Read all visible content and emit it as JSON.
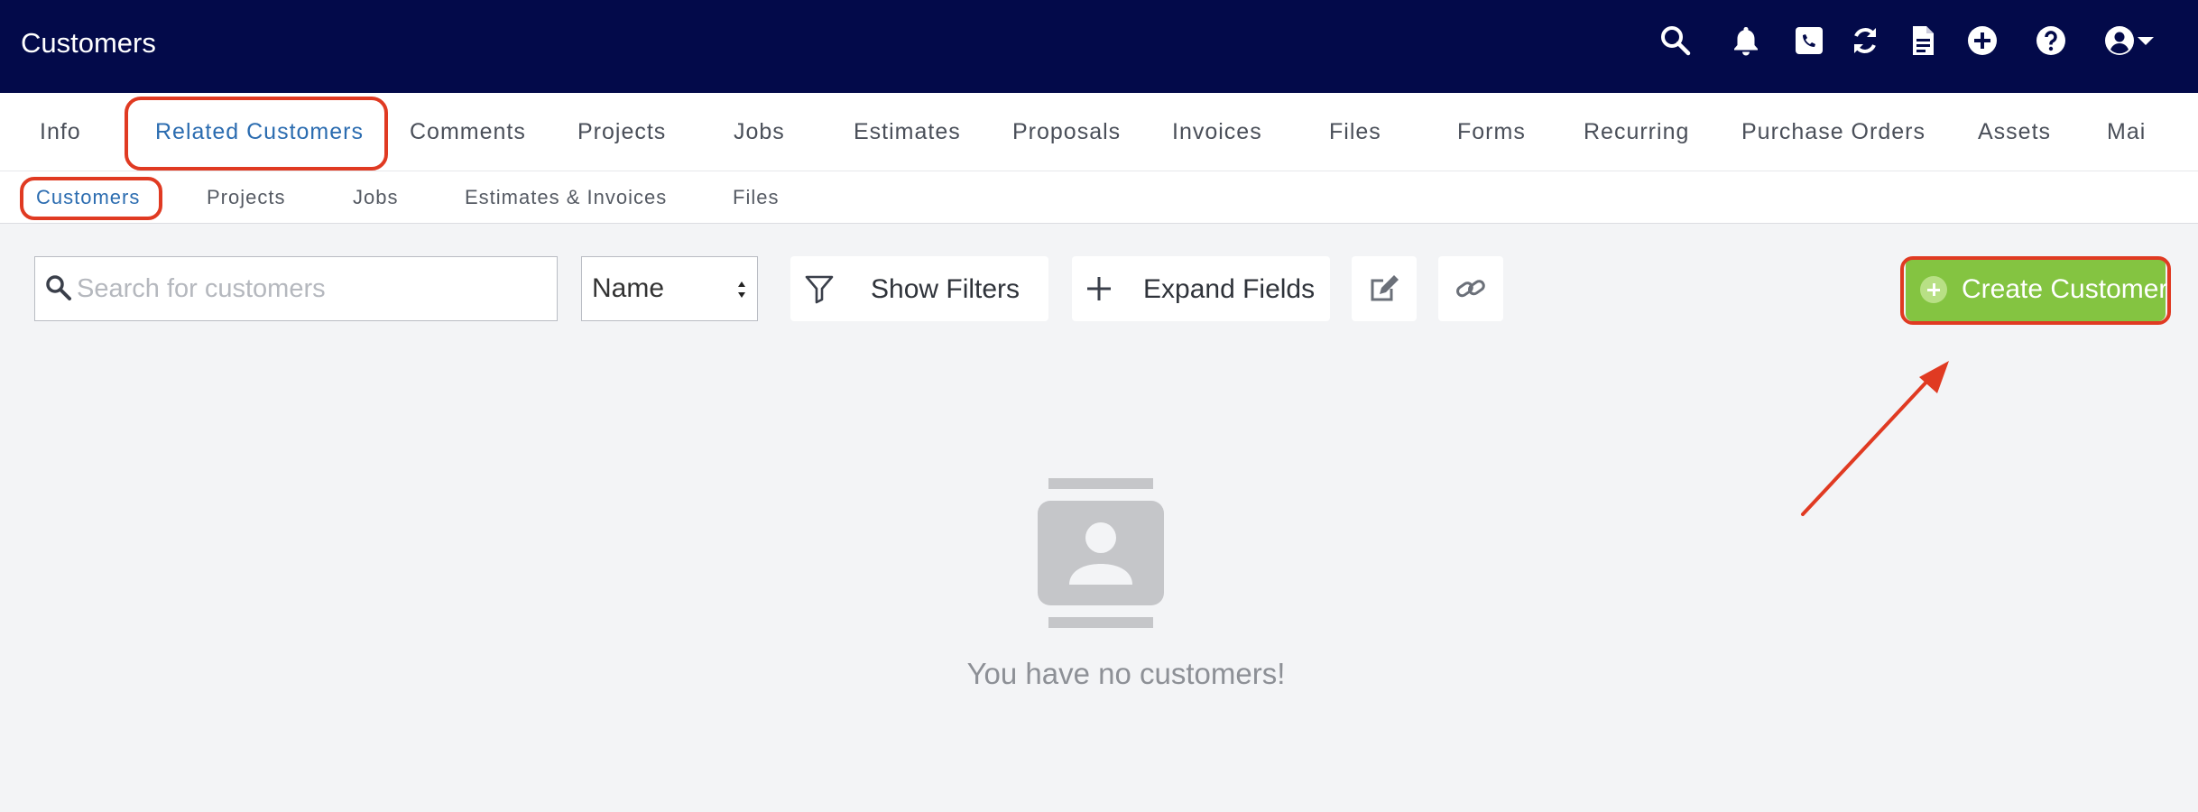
{
  "app": {
    "title": "Customers"
  },
  "header_icons": [
    "search-icon",
    "bell-icon",
    "phone-icon",
    "sync-icon",
    "document-icon",
    "add-circle-icon",
    "help-icon",
    "user-account-icon",
    "caret-down-icon"
  ],
  "tabs": [
    {
      "label": "Info"
    },
    {
      "label": "Related Customers",
      "active": true
    },
    {
      "label": "Comments"
    },
    {
      "label": "Projects"
    },
    {
      "label": "Jobs"
    },
    {
      "label": "Estimates"
    },
    {
      "label": "Proposals"
    },
    {
      "label": "Invoices"
    },
    {
      "label": "Files"
    },
    {
      "label": "Forms"
    },
    {
      "label": "Recurring"
    },
    {
      "label": "Purchase Orders"
    },
    {
      "label": "Assets"
    },
    {
      "label": "Mai"
    }
  ],
  "subtabs": [
    {
      "label": "Customers",
      "active": true
    },
    {
      "label": "Projects"
    },
    {
      "label": "Jobs"
    },
    {
      "label": "Estimates & Invoices"
    },
    {
      "label": "Files"
    }
  ],
  "toolbar": {
    "search_placeholder": "Search for customers",
    "sort_select": "Name",
    "show_filters": "Show Filters",
    "expand_fields": "Expand Fields",
    "create_customer": "Create Customer"
  },
  "empty_state": {
    "message": "You have no customers!"
  },
  "colors": {
    "header_bg": "#030a4a",
    "active_tab": "#2b6cb0",
    "create_button": "#84c441",
    "highlight": "#e03a22"
  }
}
